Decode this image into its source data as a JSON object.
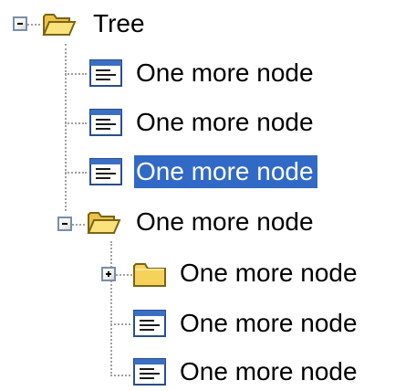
{
  "tree": {
    "root": {
      "label": "Tree",
      "icon": "folder-open-icon",
      "expanded": true,
      "children": [
        {
          "label": "One more node",
          "icon": "document-icon"
        },
        {
          "label": "One more node",
          "icon": "document-icon"
        },
        {
          "label": "One more node",
          "icon": "document-icon",
          "selected": true
        },
        {
          "label": "One more node",
          "icon": "folder-open-icon",
          "expanded": true,
          "children": [
            {
              "label": "One more node",
              "icon": "folder-closed-icon",
              "expanded": false
            },
            {
              "label": "One more node",
              "icon": "document-icon"
            },
            {
              "label": "One more node",
              "icon": "document-icon"
            }
          ]
        }
      ]
    }
  },
  "colors": {
    "selection": "#3169c6",
    "connector": "#a0a0a0",
    "folder": "#f5d25a"
  }
}
